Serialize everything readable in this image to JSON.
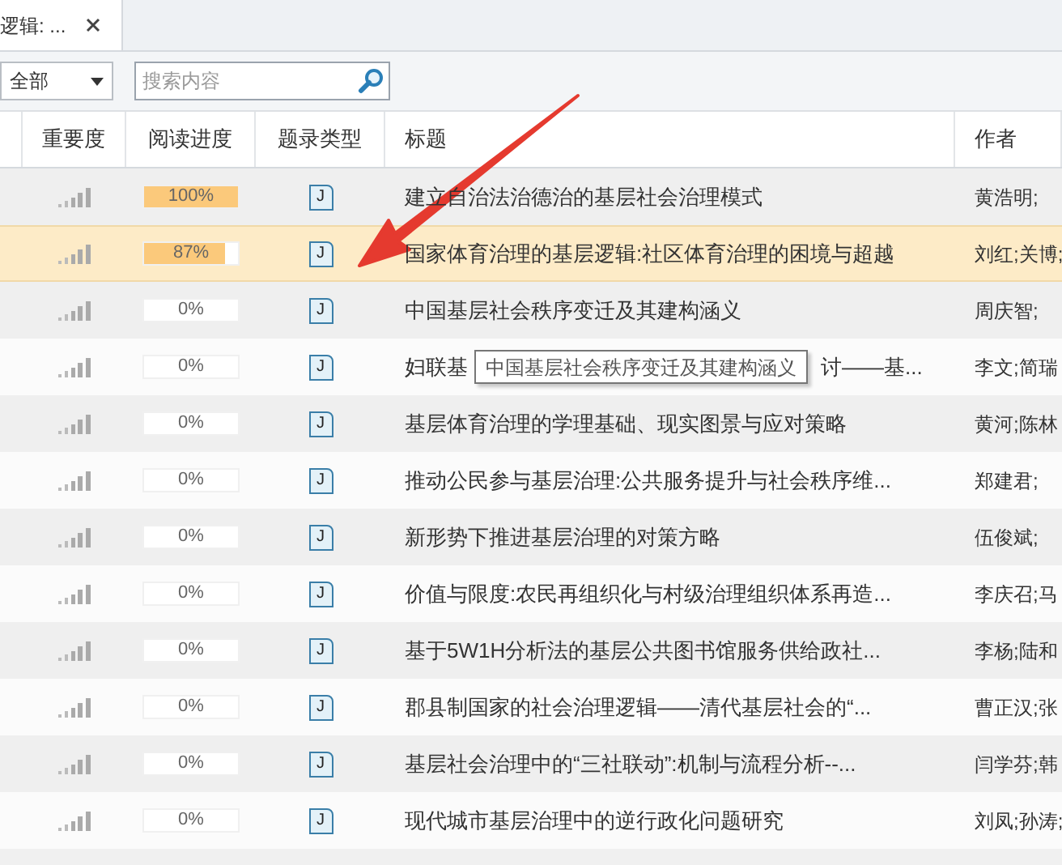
{
  "tab": {
    "title": "逻辑: ..."
  },
  "toolbar": {
    "filter": "全部",
    "search": {
      "placeholder": "搜索内容"
    }
  },
  "table": {
    "columns": [
      "重要度",
      "阅读进度",
      "题录类型",
      "标题",
      "作者"
    ],
    "rows": [
      {
        "selected": false,
        "level": 1,
        "progress": "100%",
        "type": "J",
        "title": "建立自治法治德治的基层社会治理模式",
        "author": "黄浩明;"
      },
      {
        "selected": true,
        "level": 0.87,
        "progress": "87%",
        "type": "J",
        "title": "国家体育治理的基层逻辑:社区体育治理的困境与超越",
        "author": "刘红;关博;"
      },
      {
        "selected": false,
        "level": 0,
        "progress": "0%",
        "type": "J",
        "title": "中国基层社会秩序变迁及其建构涵义",
        "author": "周庆智;"
      },
      {
        "selected": false,
        "level": 0,
        "progress": "0%",
        "type": "J",
        "title_parts": [
          "妇联基",
          "讨——基..."
        ],
        "author": "李文;简瑞"
      },
      {
        "selected": false,
        "level": 0,
        "progress": "0%",
        "type": "J",
        "title": "基层体育治理的学理基础、现实图景与应对策略",
        "author": "黄河;陈林"
      },
      {
        "selected": false,
        "level": 0,
        "progress": "0%",
        "type": "J",
        "title": "推动公民参与基层治理:公共服务提升与社会秩序维...",
        "author": "郑建君;"
      },
      {
        "selected": false,
        "level": 0,
        "progress": "0%",
        "type": "J",
        "title": "新形势下推进基层治理的对策方略",
        "author": "伍俊斌;"
      },
      {
        "selected": false,
        "level": 0,
        "progress": "0%",
        "type": "J",
        "title": "价值与限度:农民再组织化与村级治理组织体系再造...",
        "author": "李庆召;马"
      },
      {
        "selected": false,
        "level": 0,
        "progress": "0%",
        "type": "J",
        "title": "基于5W1H分析法的基层公共图书馆服务供给政社...",
        "author": "李杨;陆和"
      },
      {
        "selected": false,
        "level": 0,
        "progress": "0%",
        "type": "J",
        "title": "郡县制国家的社会治理逻辑——清代基层社会的“...",
        "author": "曹正汉;张"
      },
      {
        "selected": false,
        "level": 0,
        "progress": "0%",
        "type": "J",
        "title": "基层社会治理中的“三社联动”:机制与流程分析--...",
        "author": "闫学芬;韩"
      },
      {
        "selected": false,
        "level": 0,
        "progress": "0%",
        "type": "J",
        "title": "现代城市基层治理中的逆行政化问题研究",
        "author": "刘凤;孙涛;"
      }
    ]
  },
  "tooltip": "中国基层社会秩序变迁及其建构涵义"
}
